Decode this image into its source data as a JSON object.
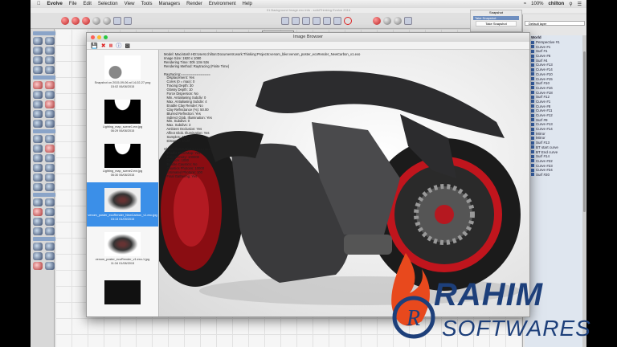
{
  "menubar": {
    "app": "Evolve",
    "items": [
      "File",
      "Edit",
      "Selection",
      "View",
      "Tools",
      "Managers",
      "Render",
      "Environment",
      "Help"
    ],
    "battery": "100%",
    "user": "chilton"
  },
  "window_title": "01 Background Image.exo info - solidThinking Evolve 2016",
  "viewport_label": "Perspective #1",
  "snapshot": {
    "title": "Snapshot",
    "tab": "Take Snapshot",
    "button": "Take Snapshot"
  },
  "layer_select": "Default layer",
  "tree": [
    "World",
    "Perspective #1",
    "Curve #1",
    "Surf #1",
    "Curve #6",
    "Surf #4",
    "Curve #13",
    "Curve #14",
    "Curve #10",
    "Curve #15",
    "Surf #10",
    "Curve #16",
    "Curve #18",
    "Surf #12",
    "Curve #1",
    "Curve #8",
    "Curve #11",
    "Curve #12",
    "Surf #9",
    "Curve #13",
    "Curve #14",
    "Mirror",
    "Mirror",
    "Surf #13",
    "BT start curve",
    "BT End curve",
    "Surf #14",
    "Curve #22",
    "Curve #23",
    "Curve #24",
    "Surf #20"
  ],
  "image_browser": {
    "title": "Image Browser",
    "thumbnails": [
      {
        "name": "Snapshot on 2015-09-06 at 14-02-27.png",
        "date": "15:02 06/08/2015"
      },
      {
        "name": "Lighting_map_scene1.exr.jpg",
        "date": "06:29 06/08/2015"
      },
      {
        "name": "Lighting_map_scene2.exr.jpg",
        "date": "06:30 06/08/2015"
      },
      {
        "name": "venom_poster_ecoRender_NewCarbon_v1.exo.jpg",
        "date": "15:13 01/09/2015"
      },
      {
        "name": "venom_poster_ecoRender_v1.exo-1.jpg",
        "date": "11:34 01/08/2015"
      },
      {
        "name": "",
        "date": ""
      }
    ],
    "info": "Model: Macintosh HD:Users:chilton:Documents:work:Thinking:Projects:venom_bike:venom_poster_ecoRender_NewCarbon_v1.exo\nImage Size: 1920 x 1080\nRendering Time: 00h 13m 53s\nRendering Method: Raytracing (Finite Time)\n\nRaytracing:===============\n   Displacement: Yes\n   Cores (0 = max): 0\n   Tracing Depth: 30\n   Glossy Depth: 10\n   Force Dispersion: No\n   Min. Antialiasing Subdiv: 0\n   Max. Antialiasing Subdiv: 4\n   Enable Clay Render: No\n   Clay Reflectance (%): 50.00\n   Blurred Reflection: Yes\n   Indirect Glob. Illumination: Yes\n   Min. Subdivs: 0\n   Max. Subdivs: 3\n   Ambient Occlusion: Yes\n   Affect Glob. Illumination: Yes\n   Samples: 100\n   Distance: 10.00\n\nGlobal Illumination:===============\n   Enable Field Map: Yes\n   Field Density: 100000\n   Cell size: 1000\n   Enable Caustics: No\n   Caustics Photons: 10000\n   Estimated Photons: 100\n   Final Gathering: Yes"
  },
  "watermark": {
    "line1": "RAHIM",
    "line2": "SOFTWARES"
  }
}
